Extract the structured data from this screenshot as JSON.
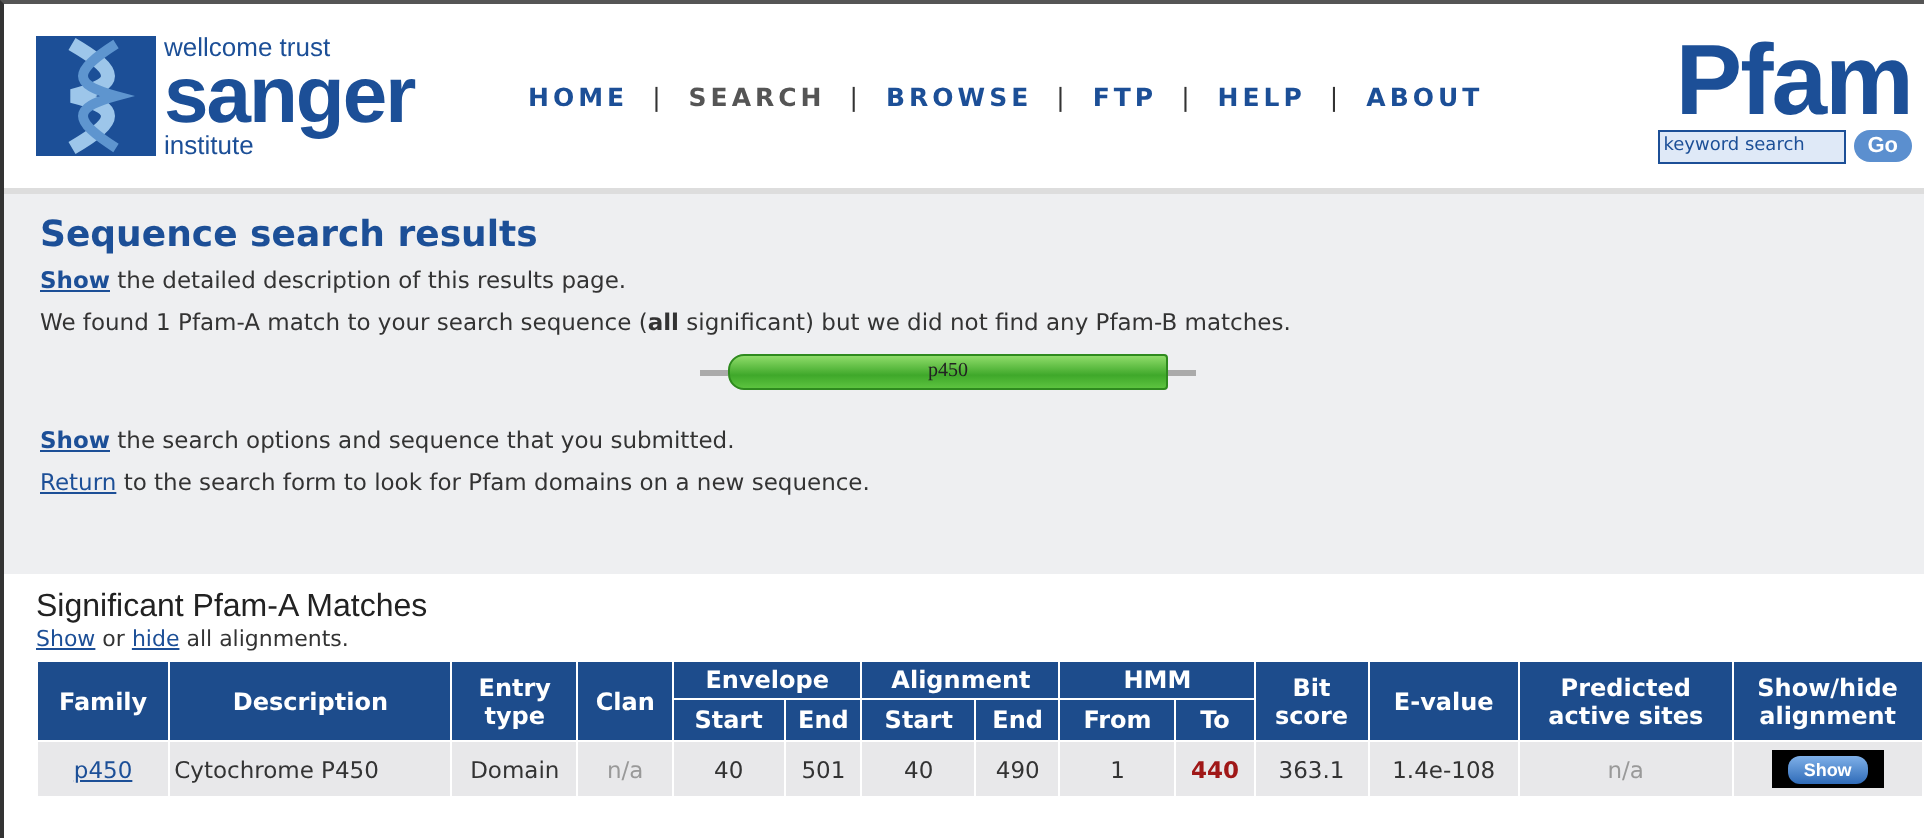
{
  "header": {
    "logo": {
      "line1": "wellcome trust",
      "line2": "sanger",
      "line3": "institute"
    },
    "nav": [
      {
        "label": "HOME",
        "selected": false
      },
      {
        "label": "SEARCH",
        "selected": true
      },
      {
        "label": "BROWSE",
        "selected": false
      },
      {
        "label": "FTP",
        "selected": false
      },
      {
        "label": "HELP",
        "selected": false
      },
      {
        "label": "ABOUT",
        "selected": false
      }
    ],
    "separator": "|",
    "pfam_logo": "Pfam",
    "search": {
      "placeholder": "keyword search",
      "button": "Go"
    }
  },
  "results": {
    "title": "Sequence search results",
    "lines_top": [
      {
        "link": "Show",
        "text": " the detailed description of this results page."
      },
      {
        "text": "We found 1 Pfam-A match to your search sequence (**all** significant) but we did not find any Pfam-B matches."
      }
    ],
    "domain_bar": {
      "label": "p450"
    },
    "lines_bottom": [
      {
        "link": "Show",
        "text": " the search options and sequence that you submitted."
      },
      {
        "link": "Return",
        "text": " to the search form to look for Pfam domains on a new sequence."
      }
    ]
  },
  "matches": {
    "title": "Significant Pfam-A Matches",
    "toggle": {
      "show": "Show",
      "middle": " or ",
      "hide": "hide",
      "rest": " all alignments."
    },
    "columns": [
      {
        "label": "Family"
      },
      {
        "label": "Description"
      },
      {
        "label": "Entry type"
      },
      {
        "label": "Clan"
      },
      {
        "label": "Envelope",
        "colspan": 2,
        "sub": [
          "Start",
          "End"
        ]
      },
      {
        "label": "Alignment",
        "colspan": 2,
        "sub": [
          "Start",
          "End"
        ]
      },
      {
        "label": "HMM",
        "colspan": 2,
        "sub": [
          "From",
          "To"
        ]
      },
      {
        "label": "Bit score"
      },
      {
        "label": "E-value"
      },
      {
        "label": "Predicted active sites"
      },
      {
        "label": "Show/hide alignment"
      }
    ],
    "rows": [
      [
        {
          "kind": "link",
          "text": "p450"
        },
        {
          "kind": "plain",
          "text": "Cytochrome P450"
        },
        {
          "kind": "plain",
          "text": "Domain"
        },
        {
          "kind": "na",
          "text": "n/a"
        },
        {
          "kind": "plain",
          "text": "40"
        },
        {
          "kind": "plain",
          "text": "501"
        },
        {
          "kind": "plain",
          "text": "40"
        },
        {
          "kind": "plain",
          "text": "490"
        },
        {
          "kind": "plain",
          "text": "1"
        },
        {
          "kind": "hit",
          "text": "440"
        },
        {
          "kind": "plain",
          "text": "363.1"
        },
        {
          "kind": "plain",
          "text": "1.4e-108"
        },
        {
          "kind": "na",
          "text": "n/a"
        },
        {
          "kind": "button",
          "text": "Show"
        }
      ]
    ]
  }
}
